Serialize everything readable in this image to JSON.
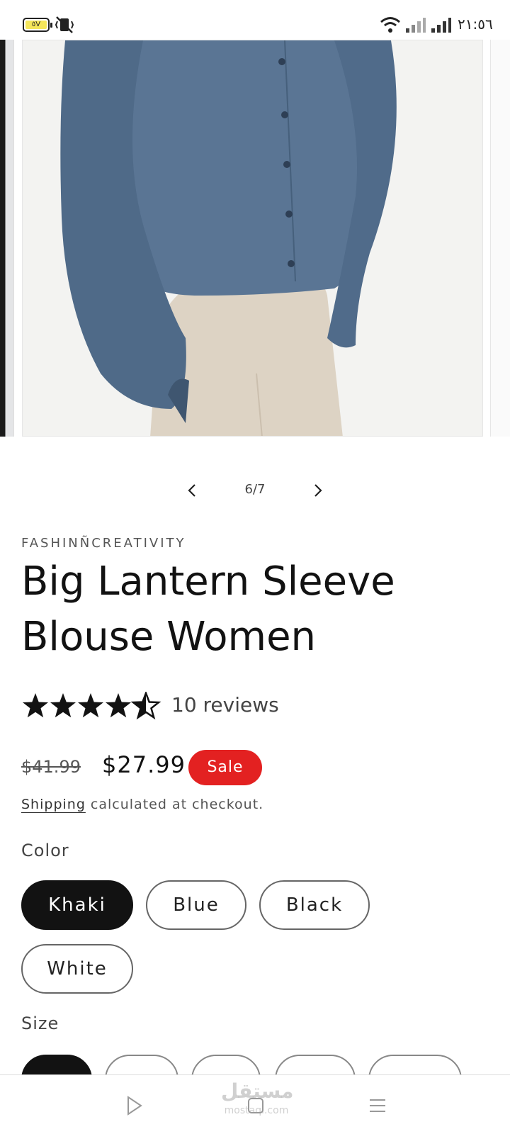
{
  "status_bar": {
    "time": "٢١:٥٦",
    "battery_label": "٥V"
  },
  "gallery": {
    "counter": "6/7",
    "current": 6,
    "total": 7
  },
  "product": {
    "vendor": "FASHINÑCREATIVITY",
    "title": "Big Lantern Sleeve Blouse Women",
    "rating": 4.5,
    "rating_max": 5,
    "reviews": "10 reviews",
    "price_old": "$41.99",
    "price_new": "$27.99",
    "badge": "Sale",
    "shipping_link": "Shipping",
    "shipping_text": " calculated at checkout."
  },
  "options": {
    "color_label": "Color",
    "colors": [
      "Khaki",
      "Blue",
      "Black",
      "White"
    ],
    "selected_color": "Khaki",
    "size_label": "Size"
  },
  "watermark": {
    "text": "مستقل",
    "sub": "mostaql.com"
  },
  "colors": {
    "sale": "#e32121",
    "selected_pill": "#121212",
    "shirt": "#5a7594",
    "pants": "#ddd3c4"
  }
}
